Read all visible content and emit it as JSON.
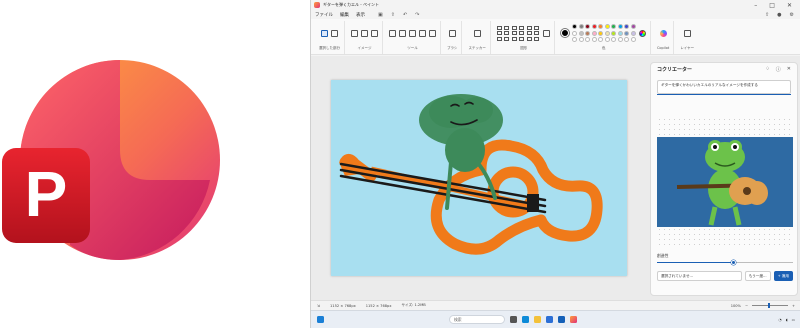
{
  "window": {
    "title": "ギターを弾くカエル - ペイント"
  },
  "menubar": {
    "items": [
      "ファイル",
      "編集",
      "表示"
    ]
  },
  "ribbon": {
    "groups": [
      "選択した部分",
      "イメージ",
      "ツール",
      "ブラシ",
      "ステッカー",
      "図形",
      "色",
      "Copilot",
      "レイヤー"
    ]
  },
  "copilot_panel": {
    "title": "コクリエーター",
    "prompt": "ギターを弾くかわいいカエルのリアルなイメージを作成する",
    "creativity_label": "創造性",
    "creativity_value": 0.56,
    "style_dropdown": "選択されていませ…",
    "retry_label": "もう一度…",
    "apply_label": "+ 適用"
  },
  "statusbar": {
    "pos1": "1152 × 768px",
    "pos2": "1152 × 768px",
    "size": "サイズ: 1.2MB",
    "zoom": "100%"
  },
  "taskbar": {
    "search_placeholder": "検索"
  },
  "colors": {
    "accent": "#1a5fb4",
    "canvas_bg": "#a8dff0",
    "guitar": "#f07a1a",
    "frog": "#3d8a5a"
  }
}
